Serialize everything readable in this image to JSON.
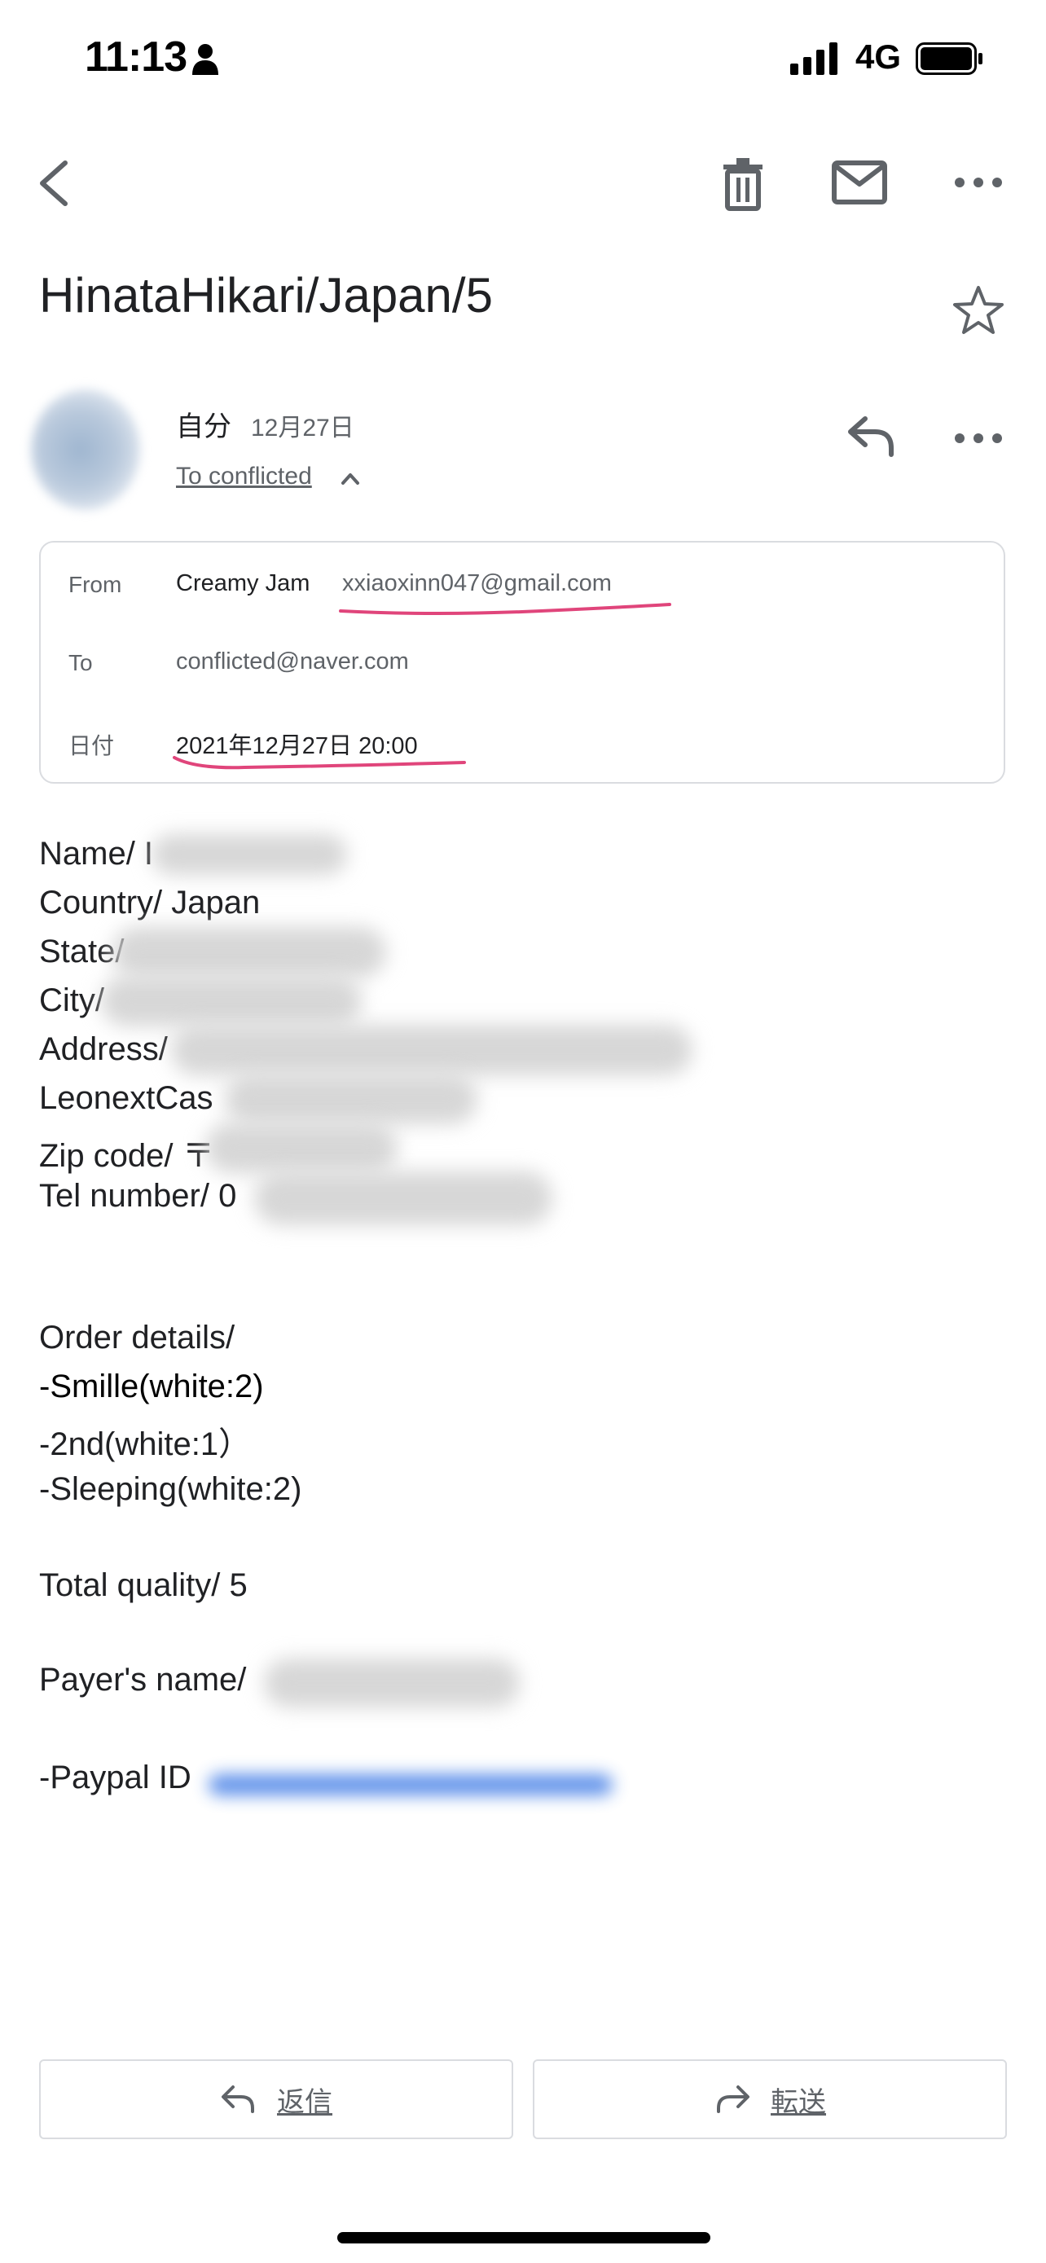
{
  "status_bar": {
    "time": "11:13",
    "network": "4G"
  },
  "subject": "HinataHikari/Japan/5",
  "sender": {
    "name": "自分",
    "date": "12月27日",
    "recipient_toggle": "To conflicted"
  },
  "details": {
    "from_label": "From",
    "from_name": "Creamy Jam",
    "from_email": "xxiaoxinn047@gmail.com",
    "to_label": "To",
    "to_value": "conflicted@naver.com",
    "date_label": "日付",
    "date_value": "2021年12月27日 20:00"
  },
  "body": {
    "name": "Name/ I",
    "country": "Country/ Japan",
    "state": "State/",
    "city": "City/",
    "address": "Address/",
    "leonext": "LeonextCas",
    "zip": "Zip code/ 〒",
    "tel": "Tel number/ 0",
    "order_heading": "Order details/",
    "order_items": [
      "-Smille(white:2)",
      "-2nd(white:1）",
      "-Sleeping(white:2)"
    ],
    "total": "Total quality/ 5",
    "payer": "Payer's name/",
    "paypal": "-Paypal ID"
  },
  "actions": {
    "reply_label": "返信",
    "forward_label": "転送"
  },
  "colors": {
    "annotation": "#e0457b",
    "link_blue": "#4f86e8"
  }
}
